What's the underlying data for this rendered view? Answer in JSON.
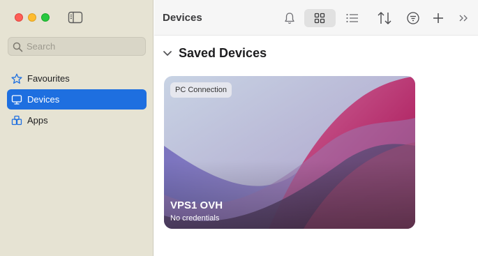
{
  "sidebar": {
    "search_placeholder": "Search",
    "items": [
      {
        "label": "Favourites",
        "icon": "star-icon"
      },
      {
        "label": "Devices",
        "icon": "monitor-icon",
        "active": true
      },
      {
        "label": "Apps",
        "icon": "apps-icon"
      }
    ]
  },
  "toolbar": {
    "title": "Devices",
    "buttons": [
      "bell-icon",
      "grid-view-icon",
      "list-view-icon",
      "sort-icon",
      "filter-icon",
      "plus-icon",
      "chevrons-right-icon"
    ]
  },
  "main": {
    "section_title": "Saved Devices",
    "cards": [
      {
        "badge": "PC Connection",
        "name": "VPS1 OVH",
        "subtitle": "No credentials"
      }
    ]
  },
  "colors": {
    "accent": "#1e6fe0",
    "sidebar_bg": "#e6e3d3",
    "close": "#fe5f57",
    "minimize": "#febc2e",
    "zoom": "#28c840"
  }
}
